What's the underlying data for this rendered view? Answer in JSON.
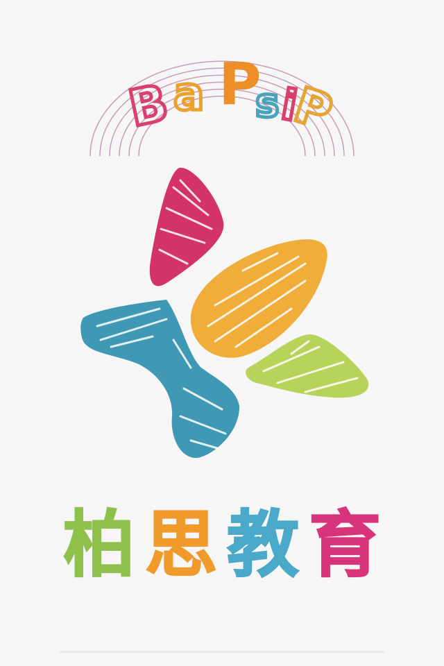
{
  "logo": {
    "wordmark_letters": [
      "B",
      "a",
      "P",
      "s",
      "i",
      "P"
    ],
    "wordmark_colors": [
      "#d8416e",
      "#eba12e",
      "#ed8f26",
      "#48a3bd",
      "#d8416e",
      "#e4a534"
    ],
    "arc_color": "#b77fa6",
    "petal_colors": {
      "pink": "#d3336a",
      "orange": "#f0ad3a",
      "blue": "#3f98b4",
      "green": "#b7d35a"
    }
  },
  "brand_name": {
    "chars": [
      "柏",
      "思",
      "教",
      "育"
    ],
    "colors": [
      "#8fc04b",
      "#ef9a2a",
      "#4aa8c8",
      "#d7347a"
    ]
  }
}
